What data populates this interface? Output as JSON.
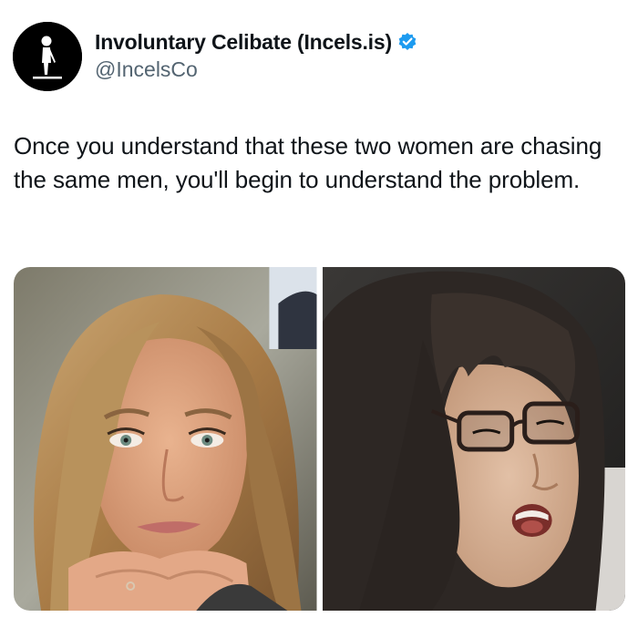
{
  "author": {
    "display_name": "Involuntary Celibate (Incels.is)",
    "handle": "@IncelsCo",
    "verified": true,
    "avatar_icon": "standing-figure-logo-icon"
  },
  "tweet": {
    "text": "Once you understand that these two women are chasing the same men, you'll begin to understand the problem."
  },
  "media": [
    {
      "name": "photo-left",
      "description_icon": "blonde-woman-photo"
    },
    {
      "name": "photo-right",
      "description_icon": "woman-with-glasses-photo"
    }
  ],
  "colors": {
    "text_primary": "#0f1419",
    "text_secondary": "#536471",
    "verified_blue": "#1d9bf0",
    "avatar_bg": "#000000"
  }
}
